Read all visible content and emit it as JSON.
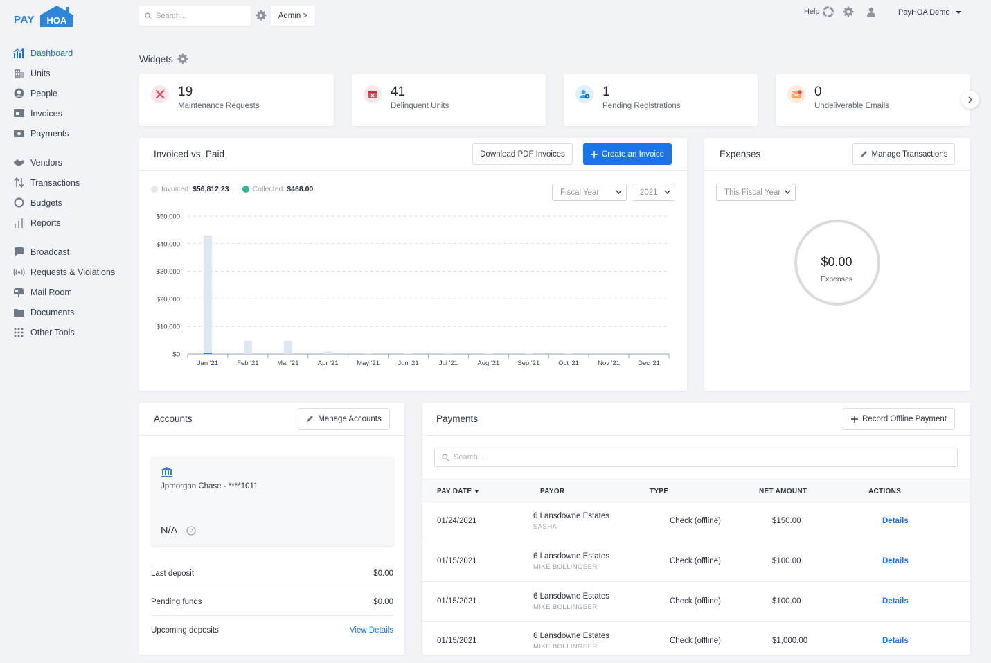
{
  "app": {
    "logo_pay": "PAY",
    "logo_hoa": "HOA",
    "search_placeholder": "Search...",
    "admin_label": "Admin >",
    "help_label": "Help",
    "account_name": "PayHOA Demo"
  },
  "sidebar": {
    "items": [
      {
        "label": "Dashboard",
        "icon": "chart-icon",
        "active": true
      },
      {
        "label": "Units",
        "icon": "building-icon"
      },
      {
        "label": "People",
        "icon": "person-icon"
      },
      {
        "label": "Invoices",
        "icon": "invoice-icon"
      },
      {
        "label": "Payments",
        "icon": "money-icon"
      },
      {
        "label": "Vendors",
        "icon": "handshake-icon"
      },
      {
        "label": "Transactions",
        "icon": "arrows-icon"
      },
      {
        "label": "Budgets",
        "icon": "circle-icon"
      },
      {
        "label": "Reports",
        "icon": "bars-icon"
      },
      {
        "label": "Broadcast",
        "icon": "chat-icon"
      },
      {
        "label": "Requests & Violations",
        "icon": "signal-icon"
      },
      {
        "label": "Mail Room",
        "icon": "mailbox-icon"
      },
      {
        "label": "Documents",
        "icon": "folder-icon"
      },
      {
        "label": "Other Tools",
        "icon": "grid-icon"
      }
    ]
  },
  "widgets": {
    "title": "Widgets",
    "cards": [
      {
        "value": "19",
        "label": "Maintenance Requests",
        "color": "#e8455a"
      },
      {
        "value": "41",
        "label": "Delinquent Units",
        "color": "#e8455a"
      },
      {
        "value": "1",
        "label": "Pending Registrations",
        "color": "#3aa0d8"
      },
      {
        "value": "0",
        "label": "Undeliverable Emails",
        "color": "#f08a3c"
      }
    ]
  },
  "invoiced": {
    "title": "Invoiced vs. Paid",
    "download_label": "Download PDF Invoices",
    "create_label": "Create an Invoice",
    "legend_invoiced_label": "Invoiced:",
    "legend_invoiced_value": "$56,812.23",
    "legend_collected_label": "Collected:",
    "legend_collected_value": "$468.00",
    "period_select": "Fiscal Year",
    "year_select": "2021"
  },
  "chart_data": {
    "type": "bar",
    "categories": [
      "Jan '21",
      "Feb '21",
      "Mar '21",
      "Apr '21",
      "May '21",
      "Jun '21",
      "Jul '21",
      "Aug '21",
      "Sep '21",
      "Oct '21",
      "Nov '21",
      "Dec '21"
    ],
    "series": [
      {
        "name": "Invoiced",
        "values": [
          43000,
          4800,
          4800,
          900,
          350,
          200,
          500,
          150,
          200,
          200,
          0,
          0
        ],
        "color": "#dde7f1"
      },
      {
        "name": "Collected",
        "values": [
          468,
          0,
          0,
          0,
          0,
          0,
          0,
          0,
          0,
          0,
          0,
          0
        ],
        "color": "#2f7fd6"
      }
    ],
    "yticks": [
      "$50,000",
      "$40,000",
      "$30,000",
      "$20,000",
      "$10,000",
      "$0"
    ],
    "ylim": [
      0,
      50000
    ],
    "grid": true
  },
  "expenses": {
    "title": "Expenses",
    "manage_label": "Manage Transactions",
    "period_select": "This Fiscal Year",
    "total": "$0.00",
    "total_label": "Expenses"
  },
  "accounts": {
    "title": "Accounts",
    "manage_label": "Manage Accounts",
    "bank_name": "Jpmorgan Chase - ****1011",
    "balance": "N/A",
    "rows": [
      {
        "label": "Last deposit",
        "value": "$0.00"
      },
      {
        "label": "Pending funds",
        "value": "$0.00"
      },
      {
        "label": "Upcoming deposits",
        "value": "View Details"
      }
    ]
  },
  "payments": {
    "title": "Payments",
    "record_label": "Record Offline Payment",
    "search_placeholder": "Search...",
    "columns": [
      "PAY DATE",
      "PAYOR",
      "TYPE",
      "NET AMOUNT",
      "ACTIONS"
    ],
    "rows": [
      {
        "date": "01/24/2021",
        "payor": "6 Lansdowne Estates",
        "payor_sub": "SASHA",
        "type": "Check (offline)",
        "amount": "$150.00",
        "action": "Details"
      },
      {
        "date": "01/15/2021",
        "payor": "6 Lansdowne Estates",
        "payor_sub": "MIKE BOLLINGEER",
        "type": "Check (offline)",
        "amount": "$100.00",
        "action": "Details"
      },
      {
        "date": "01/15/2021",
        "payor": "6 Lansdowne Estates",
        "payor_sub": "MIKE BOLLINGEER",
        "type": "Check (offline)",
        "amount": "$100.00",
        "action": "Details"
      },
      {
        "date": "01/15/2021",
        "payor": "6 Lansdowne Estates",
        "payor_sub": "MIKE BOLLINGEER",
        "type": "Check (offline)",
        "amount": "$1,000.00",
        "action": "Details"
      }
    ]
  }
}
